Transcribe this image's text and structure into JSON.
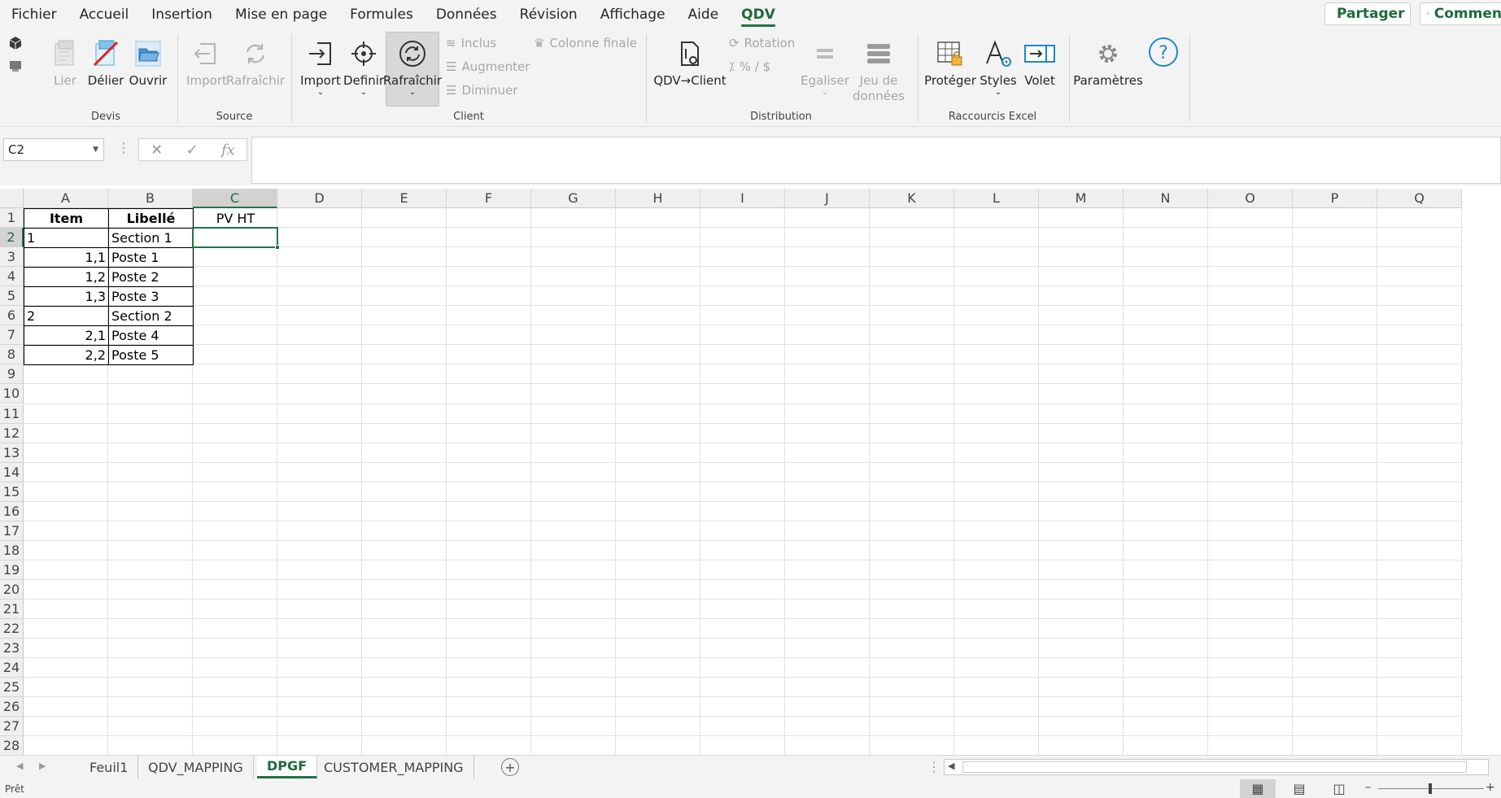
{
  "menu": {
    "items": [
      "Fichier",
      "Accueil",
      "Insertion",
      "Mise en page",
      "Formules",
      "Données",
      "Révision",
      "Affichage",
      "Aide",
      "QDV"
    ],
    "active_index": 9,
    "share_label": "Partager",
    "comments_label": "Commen"
  },
  "ribbon": {
    "groups": {
      "devis": "Devis",
      "source": "Source",
      "client": "Client",
      "distribution": "Distribution",
      "raccourcis": "Raccourcis Excel"
    },
    "buttons": {
      "lier": "Lier",
      "delier": "Délier",
      "ouvrir": "Ouvrir",
      "import_src": "Import",
      "rafraichir_src": "Rafraîchir",
      "import_cli": "Import",
      "definir": "Definir",
      "rafraichir_cli": "Rafraîchir",
      "inclus": "Inclus",
      "augmenter": "Augmenter",
      "diminuer": "Diminuer",
      "colonne_finale": "Colonne finale",
      "qdv_client": "QDV→Client",
      "rotation": "Rotation",
      "percent": "% / $",
      "egaliser": "Egaliser",
      "jeu_donnees_1": "Jeu de",
      "jeu_donnees_2": "données",
      "proteger": "Protéger",
      "styles": "Styles",
      "volet": "Volet",
      "parametres": "Paramètres"
    }
  },
  "formula_bar": {
    "name_box": "C2",
    "formula": "",
    "fx": "fx"
  },
  "grid": {
    "columns": [
      "A",
      "B",
      "C",
      "D",
      "E",
      "F",
      "G",
      "H",
      "I",
      "J",
      "K",
      "L",
      "M",
      "N",
      "O",
      "P",
      "Q"
    ],
    "selected_column": "C",
    "selected_row": 2,
    "row_count": 28,
    "cells": {
      "A1": "Item",
      "B1": "Libellé",
      "C1": "PV HT",
      "A2": "1",
      "B2": "Section 1",
      "A3": "1,1",
      "B3": "Poste 1",
      "A4": "1,2",
      "B4": "Poste 2",
      "A5": "1,3",
      "B5": "Poste 3",
      "A6": "2",
      "B6": "Section 2",
      "A7": "2,1",
      "B7": "Poste 4",
      "A8": "2,2",
      "B8": "Poste 5"
    }
  },
  "sheets": {
    "tabs": [
      "Feuil1",
      "QDV_MAPPING",
      "DPGF",
      "CUSTOMER_MAPPING"
    ],
    "active_index": 2
  },
  "status": {
    "ready": "Prêt"
  },
  "colors": {
    "accent": "#217346"
  }
}
